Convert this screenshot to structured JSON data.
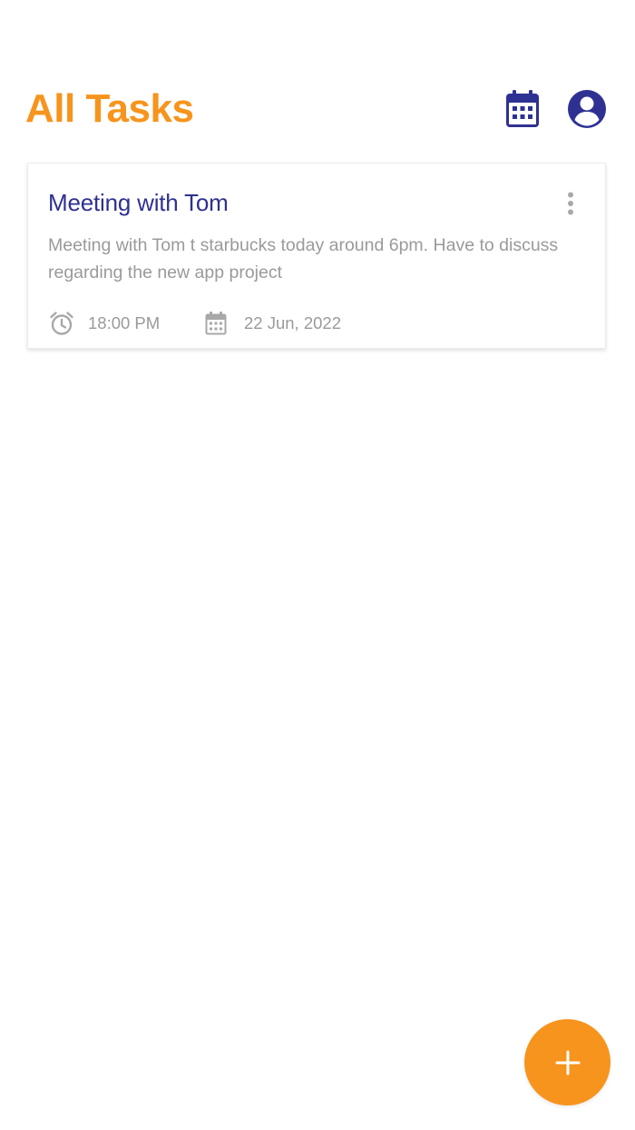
{
  "header": {
    "title": "All Tasks",
    "calendar_icon": "calendar-icon",
    "profile_icon": "account-circle-icon"
  },
  "tasks": [
    {
      "title": "Meeting with Tom",
      "description": "Meeting with Tom t starbucks today around 6pm. Have to discuss regarding the new app project",
      "time": "18:00 PM",
      "date": "22 Jun, 2022",
      "time_icon": "alarm-icon",
      "date_icon": "calendar-icon",
      "menu_icon": "more-vertical-icon"
    }
  ],
  "fab": {
    "icon": "plus-icon"
  },
  "colors": {
    "accent": "#F7941D",
    "primary": "#2E3192",
    "muted_text": "#9a9a9a",
    "background": "#ffffff"
  }
}
